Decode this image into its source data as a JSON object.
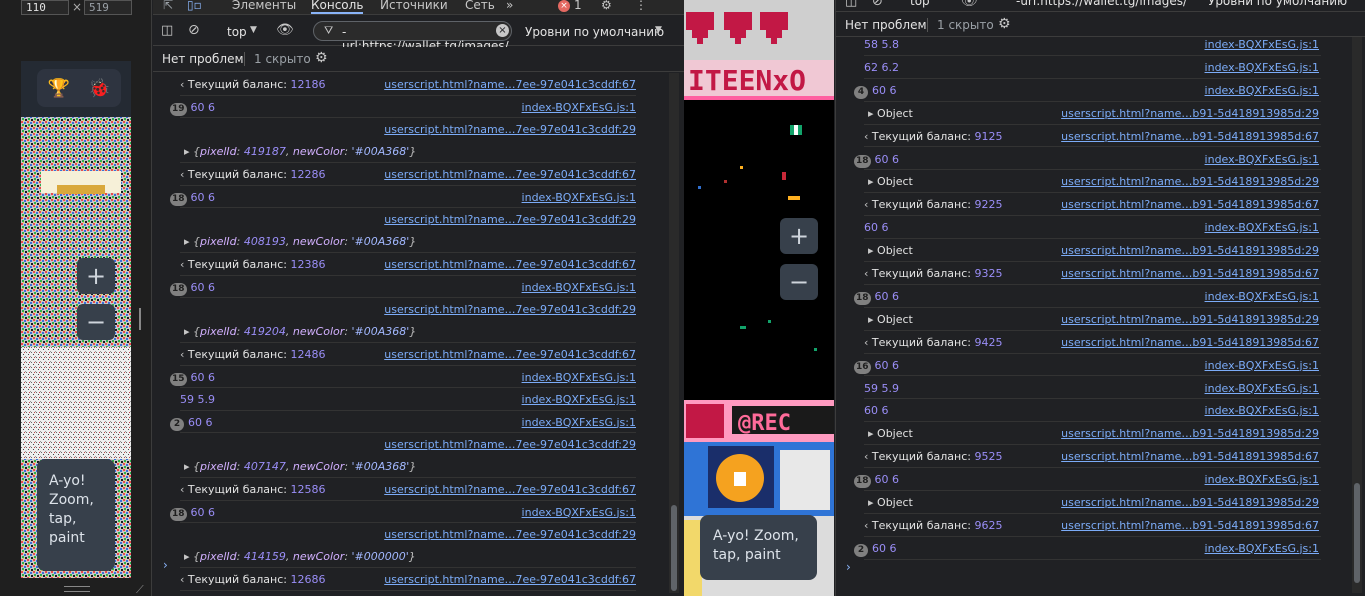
{
  "device_toolbar": {
    "width": "110",
    "height": "519",
    "times": "×"
  },
  "app": {
    "zoom_in": "+",
    "zoom_out": "−",
    "hint_left_lines": [
      "A-yo!",
      "Zoom,",
      "tap,",
      "paint"
    ],
    "hint_right_lines": [
      "A-yo! Zoom,",
      "tap, paint"
    ]
  },
  "devtools_mid": {
    "tabs": [
      "Элементы",
      "Консоль",
      "Источники",
      "Сеть"
    ],
    "active_tab": "Консоль",
    "more_tabs": "»",
    "error_count": "1",
    "context": "top",
    "filter_value": "-url:https://wallet.tg/images/",
    "levels": "Уровни по умолчанию",
    "no_issues": "Нет проблем",
    "hidden": "1 скрыто",
    "prompt": "›",
    "rows": [
      {
        "kind": "balance",
        "label": "Текущий баланс:",
        "value": "12186",
        "src": "userscript.html?name…7ee-97e041c3cddf:67"
      },
      {
        "kind": "count",
        "badge": "19",
        "text": "60 6",
        "src": "index-BQXFxEsG.js:1"
      },
      {
        "kind": "pixel",
        "pixelId": "419187",
        "color": "'#00A368'",
        "src": "userscript.html?name…7ee-97e041c3cddf:29"
      },
      {
        "kind": "balance",
        "label": "Текущий баланс:",
        "value": "12286",
        "src": "userscript.html?name…7ee-97e041c3cddf:67"
      },
      {
        "kind": "count",
        "badge": "18",
        "text": "60 6",
        "src": "index-BQXFxEsG.js:1"
      },
      {
        "kind": "pixel",
        "pixelId": "408193",
        "color": "'#00A368'",
        "src": "userscript.html?name…7ee-97e041c3cddf:29"
      },
      {
        "kind": "balance",
        "label": "Текущий баланс:",
        "value": "12386",
        "src": "userscript.html?name…7ee-97e041c3cddf:67"
      },
      {
        "kind": "count",
        "badge": "18",
        "text": "60 6",
        "src": "index-BQXFxEsG.js:1"
      },
      {
        "kind": "pixel",
        "pixelId": "419204",
        "color": "'#00A368'",
        "src": "userscript.html?name…7ee-97e041c3cddf:29"
      },
      {
        "kind": "balance",
        "label": "Текущий баланс:",
        "value": "12486",
        "src": "userscript.html?name…7ee-97e041c3cddf:67"
      },
      {
        "kind": "count",
        "badge": "15",
        "text": "60 6",
        "src": "index-BQXFxEsG.js:1"
      },
      {
        "kind": "count",
        "badge": "",
        "text": "59 5.9",
        "src": "index-BQXFxEsG.js:1"
      },
      {
        "kind": "count",
        "badge": "2",
        "text": "60 6",
        "src": "index-BQXFxEsG.js:1"
      },
      {
        "kind": "pixel",
        "pixelId": "407147",
        "color": "'#00A368'",
        "src": "userscript.html?name…7ee-97e041c3cddf:29"
      },
      {
        "kind": "balance",
        "label": "Текущий баланс:",
        "value": "12586",
        "src": "userscript.html?name…7ee-97e041c3cddf:67"
      },
      {
        "kind": "count",
        "badge": "18",
        "text": "60 6",
        "src": "index-BQXFxEsG.js:1"
      },
      {
        "kind": "pixel",
        "pixelId": "414159",
        "color": "'#000000'",
        "src": "userscript.html?name…7ee-97e041c3cddf:29"
      },
      {
        "kind": "balance",
        "label": "Текущий баланс:",
        "value": "12686",
        "src": "userscript.html?name…7ee-97e041c3cddf:67"
      }
    ]
  },
  "devtools_right": {
    "context": "top",
    "filter_value": "-url:https://wallet.tg/images/",
    "levels": "Уровни по умолчанию",
    "no_issues": "Нет проблем",
    "hidden": "1 скрыто",
    "prompt": "›",
    "rows": [
      {
        "kind": "count",
        "badge": "",
        "text": "58 5.8",
        "src": "index-BQXFxEsG.js:1"
      },
      {
        "kind": "count",
        "badge": "",
        "text": "62 6.2",
        "src": "index-BQXFxEsG.js:1"
      },
      {
        "kind": "count",
        "badge": "4",
        "text": "60 6",
        "src": "index-BQXFxEsG.js:1"
      },
      {
        "kind": "object",
        "text": "Object",
        "src": "userscript.html?name…b91-5d418913985d:29"
      },
      {
        "kind": "balance",
        "label": "Текущий баланс:",
        "value": "9125",
        "src": "userscript.html?name…b91-5d418913985d:67"
      },
      {
        "kind": "count",
        "badge": "18",
        "text": "60 6",
        "src": "index-BQXFxEsG.js:1"
      },
      {
        "kind": "object",
        "text": "Object",
        "src": "userscript.html?name…b91-5d418913985d:29"
      },
      {
        "kind": "balance",
        "label": "Текущий баланс:",
        "value": "9225",
        "src": "userscript.html?name…b91-5d418913985d:67"
      },
      {
        "kind": "count",
        "badge": "",
        "text": "60 6",
        "src": "index-BQXFxEsG.js:1"
      },
      {
        "kind": "object",
        "text": "Object",
        "src": "userscript.html?name…b91-5d418913985d:29"
      },
      {
        "kind": "balance",
        "label": "Текущий баланс:",
        "value": "9325",
        "src": "userscript.html?name…b91-5d418913985d:67"
      },
      {
        "kind": "count",
        "badge": "18",
        "text": "60 6",
        "src": "index-BQXFxEsG.js:1"
      },
      {
        "kind": "object",
        "text": "Object",
        "src": "userscript.html?name…b91-5d418913985d:29"
      },
      {
        "kind": "balance",
        "label": "Текущий баланс:",
        "value": "9425",
        "src": "userscript.html?name…b91-5d418913985d:67"
      },
      {
        "kind": "count",
        "badge": "16",
        "text": "60 6",
        "src": "index-BQXFxEsG.js:1"
      },
      {
        "kind": "count",
        "badge": "",
        "text": "59 5.9",
        "src": "index-BQXFxEsG.js:1"
      },
      {
        "kind": "count",
        "badge": "",
        "text": "60 6",
        "src": "index-BQXFxEsG.js:1"
      },
      {
        "kind": "object",
        "text": "Object",
        "src": "userscript.html?name…b91-5d418913985d:29"
      },
      {
        "kind": "balance",
        "label": "Текущий баланс:",
        "value": "9525",
        "src": "userscript.html?name…b91-5d418913985d:67"
      },
      {
        "kind": "count",
        "badge": "18",
        "text": "60 6",
        "src": "index-BQXFxEsG.js:1"
      },
      {
        "kind": "object",
        "text": "Object",
        "src": "userscript.html?name…b91-5d418913985d:29"
      },
      {
        "kind": "balance",
        "label": "Текущий баланс:",
        "value": "9625",
        "src": "userscript.html?name…b91-5d418913985d:67"
      },
      {
        "kind": "count",
        "badge": "2",
        "text": "60 6",
        "src": "index-BQXFxEsG.js:1"
      }
    ]
  },
  "canvas_text": {
    "banner": "ITEENxO",
    "bottom_banner": "@REC"
  }
}
